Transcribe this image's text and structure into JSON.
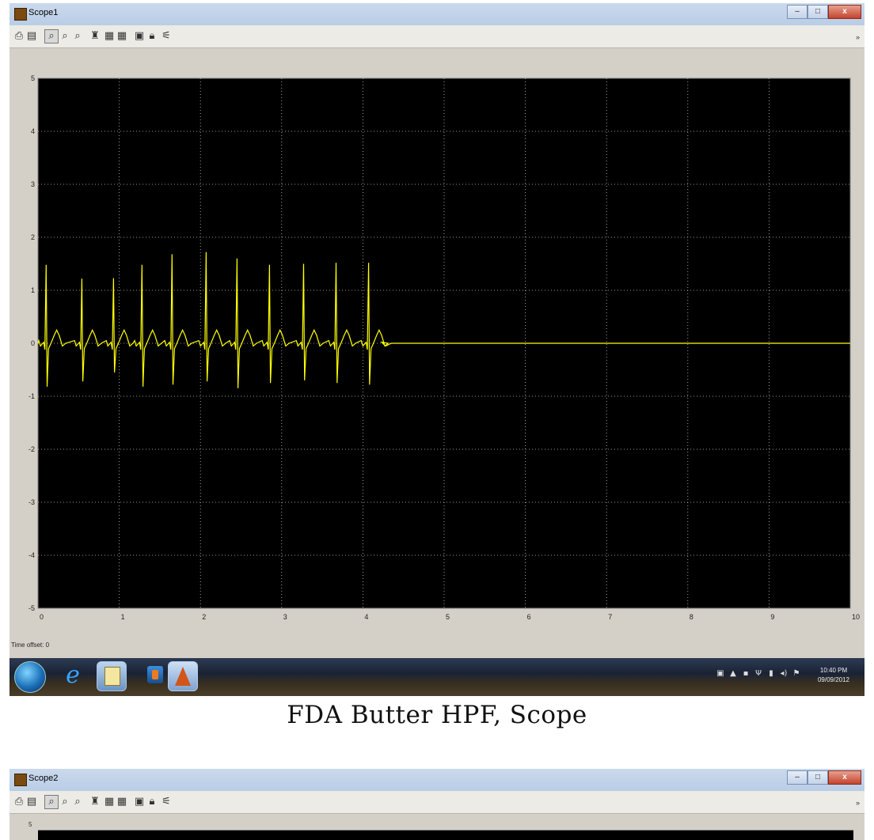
{
  "scope1": {
    "title": "Scope1",
    "window_buttons": {
      "minimize": "–",
      "maximize": "□",
      "close": "x"
    },
    "toolbar_icons": [
      "print-icon",
      "parameters-icon",
      "zoom-icon",
      "zoom-x-icon",
      "zoom-y-icon",
      "autoscale-icon",
      "save-axes-icon",
      "restore-axes-icon",
      "floating-scope-icon",
      "lock-axes-icon",
      "signal-selector-icon"
    ],
    "time_offset_label": "Time offset:  0",
    "colors": {
      "plot_bg": "#000000",
      "trace": "#ffff00",
      "grid": "#c8c8c8",
      "axes_frame": "#d4d0c8"
    },
    "taskbar": {
      "apps": [
        "start-orb-icon",
        "internet-explorer-icon",
        "sticky-notes-icon",
        "media-player-icon",
        "matlab-icon"
      ],
      "clock_time": "10:40 PM",
      "clock_date": "09/09/2012"
    }
  },
  "caption": "FDA Butter HPF, Scope",
  "scope2": {
    "title": "Scope2",
    "ytick_top": "5"
  },
  "chart_data": {
    "type": "line",
    "title": "",
    "xlabel": "",
    "ylabel": "",
    "xlim": [
      0,
      10
    ],
    "ylim": [
      -5,
      5
    ],
    "xticks": [
      "0",
      "1",
      "2",
      "3",
      "4",
      "5",
      "6",
      "7",
      "8",
      "9",
      "10"
    ],
    "yticks": [
      "5",
      "4",
      "3",
      "2",
      "1",
      "0",
      "-1",
      "-2",
      "-3",
      "-4",
      "-5"
    ],
    "grid": true,
    "series": [
      {
        "beats_r_peak_times": [
          0.1,
          0.54,
          0.93,
          1.28,
          1.65,
          2.07,
          2.45,
          2.85,
          3.27,
          3.67,
          4.07
        ],
        "r_peak_values": [
          1.48,
          1.22,
          1.23,
          1.48,
          1.68,
          1.72,
          1.6,
          1.48,
          1.5,
          1.52,
          1.52
        ],
        "s_trough_values": [
          -0.82,
          -0.72,
          -0.55,
          -0.82,
          -0.78,
          -0.72,
          -0.85,
          -0.75,
          -0.7,
          -0.75,
          -0.78
        ],
        "t_wave_value": 0.25,
        "signal_end_time": 4.35,
        "flat_value_after": 0.0
      }
    ]
  }
}
